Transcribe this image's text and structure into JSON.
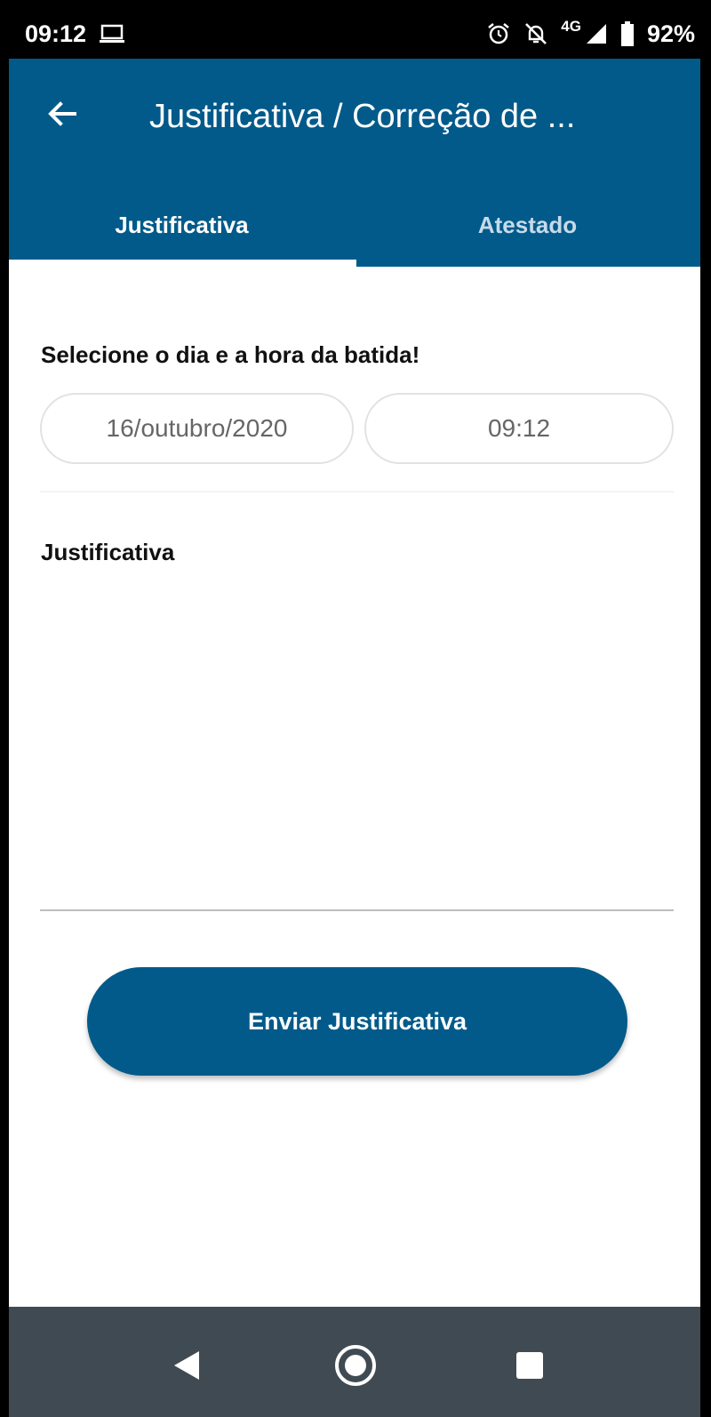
{
  "status_bar": {
    "time": "09:12",
    "network": "4G",
    "battery": "92%"
  },
  "header": {
    "title": "Justificativa / Correção de ..."
  },
  "tabs": [
    {
      "label": "Justificativa",
      "active": true
    },
    {
      "label": "Atestado",
      "active": false
    }
  ],
  "form": {
    "section_label": "Selecione o dia e a hora da batida!",
    "date_value": "16/outubro/2020",
    "time_value": "09:12",
    "justification_label": "Justificativa",
    "justification_value": "",
    "submit_label": "Enviar Justificativa"
  },
  "colors": {
    "primary": "#015a8a",
    "inactive_tab": "#c6dbe9",
    "nav_bar": "#404a52"
  },
  "icons": {
    "back": "arrow-left-icon",
    "status": [
      "laptop-icon",
      "alarm-icon",
      "notifications-off-icon",
      "signal-icon",
      "battery-icon"
    ],
    "nav": [
      "nav-back-icon",
      "nav-home-icon",
      "nav-recents-icon"
    ]
  }
}
